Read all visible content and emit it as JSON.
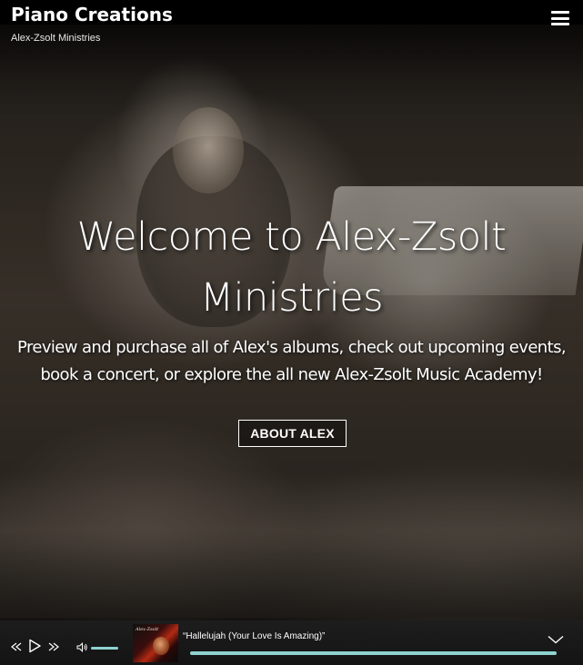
{
  "header": {
    "site_title": "Piano Creations",
    "tagline": "Alex-Zsolt Ministries",
    "menu_icon": "hamburger-menu-icon"
  },
  "hero": {
    "title": "Welcome to Alex-Zsolt Ministries",
    "subtitle": "Preview and purchase all of Alex's albums, check out upcoming events, book a concert, or explore the all new Alex-Zsolt Music Academy!",
    "button_label": "ABOUT ALEX"
  },
  "player": {
    "controls": {
      "prev_icon": "rewind-icon",
      "play_icon": "play-icon",
      "next_icon": "fast-forward-icon",
      "volume_icon": "volume-icon",
      "collapse_icon": "chevron-down-icon"
    },
    "volume_level": 1.0,
    "progress_fraction": 1.0,
    "track_title": "“Hallelujah (Your Love Is Amazing)”",
    "album_art_text": "Alex-Zsolt",
    "accent_color": "#8fd3d0"
  }
}
